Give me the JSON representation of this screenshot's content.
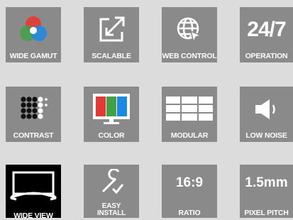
{
  "features": [
    {
      "id": "wide-gamut",
      "label": "WIDE GAMUT",
      "icon": "rgb-circles-icon"
    },
    {
      "id": "scalable",
      "label": "SCALABLE",
      "icon": "expand-arrows-icon"
    },
    {
      "id": "web-control",
      "label": "WEB CONTROL",
      "icon": "globe-cursor-icon"
    },
    {
      "id": "operation",
      "label": "OPERATION",
      "icon_text": "24/7"
    },
    {
      "id": "contrast",
      "label": "CONTRAST",
      "icon": "dot-matrix-icon"
    },
    {
      "id": "color",
      "label": "COLOR",
      "icon": "color-bars-monitor-icon"
    },
    {
      "id": "modular",
      "label": "MODULAR",
      "icon": "tile-wall-icon"
    },
    {
      "id": "low-noise",
      "label": "LOW NOISE",
      "icon": "speaker-icon"
    },
    {
      "id": "wide-view",
      "label": "WIDE VIEW",
      "icon": "wide-view-monitor-icon"
    },
    {
      "id": "easy-install",
      "label_line1": "EASY",
      "label_line2": "INSTALL",
      "icon": "wrench-check-icon"
    },
    {
      "id": "ratio",
      "label": "RATIO",
      "icon_text": "16:9"
    },
    {
      "id": "pixel-pitch",
      "label": "PIXEL PITCH",
      "icon_text": "1.5mm"
    }
  ],
  "colors": {
    "tile": "#8a8a8a",
    "background": "#dcdcdc",
    "wide_view_tile": "#000000"
  }
}
